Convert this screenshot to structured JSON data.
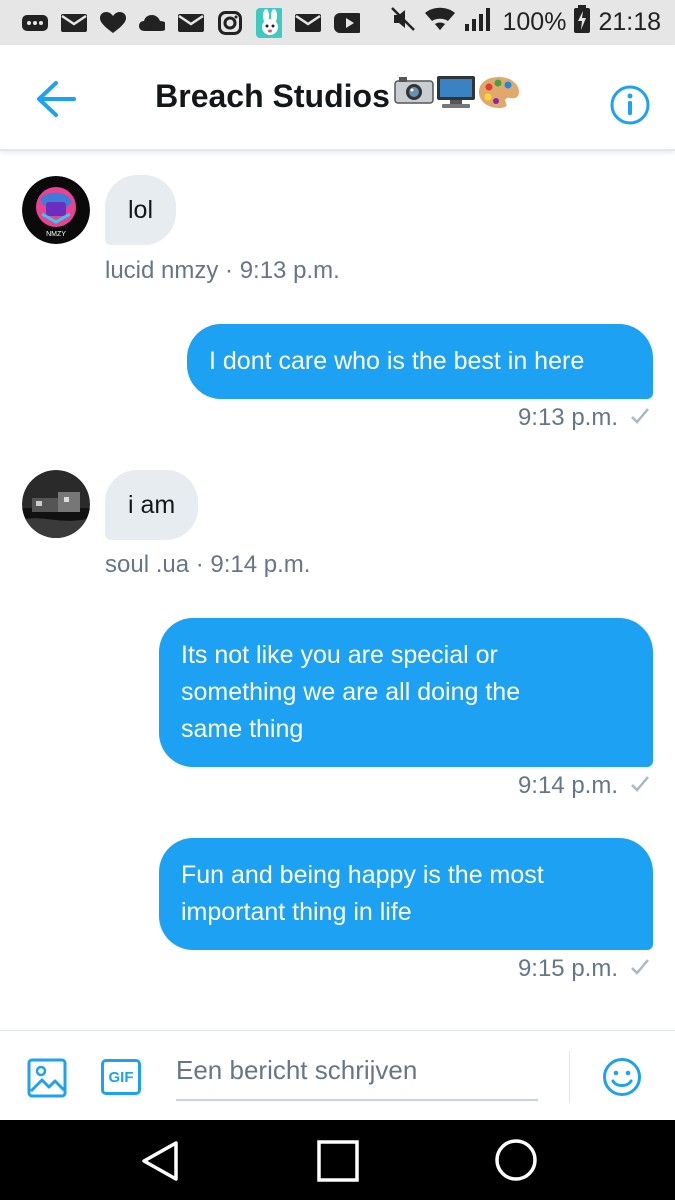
{
  "status_bar": {
    "battery_percent": "100%",
    "time": "21:18",
    "left_icons": [
      "dots-icon",
      "mail-icon",
      "heart-icon",
      "cloud-icon",
      "mail-icon",
      "instagram-icon",
      "bunny-app-icon",
      "mail-icon",
      "youtube-icon"
    ],
    "right_icons": [
      "mute-icon",
      "wifi-icon",
      "signal-icon",
      "battery-charging-icon"
    ]
  },
  "header": {
    "title": "Breach Studios",
    "title_emoji": [
      "camera-emoji",
      "computer-emoji",
      "palette-emoji"
    ],
    "back_icon": "back-arrow-icon",
    "info_icon": "info-icon"
  },
  "messages": [
    {
      "direction": "in",
      "text": "lol",
      "sender": "lucid nmzy",
      "time": "9:13 p.m.",
      "meta": "lucid nmzy · 9:13 p.m.",
      "avatar_label": "NMZY"
    },
    {
      "direction": "out",
      "text": "I dont care who is the best in here",
      "time": "9:13 p.m."
    },
    {
      "direction": "in",
      "text": "i am",
      "sender": "soul .ua",
      "time": "9:14 p.m.",
      "meta": "soul .ua · 9:14 p.m."
    },
    {
      "direction": "out",
      "text": "Its not like you are special or something we are all doing the same thing",
      "lines": [
        "Its not like you are special or",
        "something we are all doing the",
        "same thing"
      ],
      "time": "9:14 p.m."
    },
    {
      "direction": "out",
      "text": "Fun and being happy is the most important thing in life",
      "lines": [
        "Fun and being happy is the most",
        "important thing in life"
      ],
      "time": "9:15 p.m."
    }
  ],
  "composer": {
    "placeholder": "Een bericht schrijven",
    "gif_label": "GIF"
  },
  "colors": {
    "accent": "#1da1f2",
    "incoming_bubble": "#e6ecf0",
    "meta_text": "#657786"
  }
}
